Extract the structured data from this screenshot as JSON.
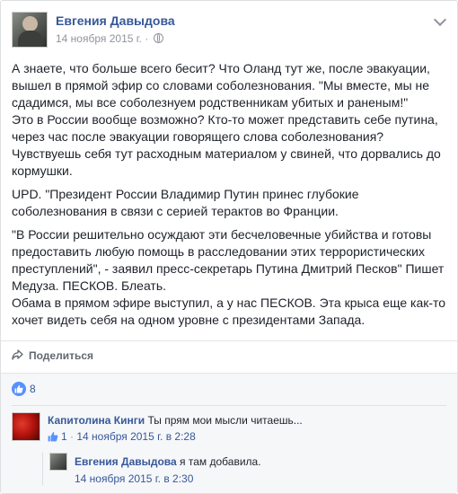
{
  "post": {
    "author": "Евгения Давыдова",
    "date": "14 ноября 2015 г.",
    "paragraphs": [
      "А знаете, что больше всего бесит? Что Оланд тут же, после эвакуации, вышел в прямой эфир со словами соболезнования. \"Мы вместе, мы не сдадимся, мы все соболезнуем родственникам убитых и раненым!\"\nЭто в России вообще возможно? Кто-то может представить себе путина, через час после эвакуации говорящего слова соболезнования? Чувствуешь себя тут расходным материалом у свиней, что дорвались до кормушки.",
      "UPD. \"Президент России Владимир Путин принес глубокие соболезнования в связи с серией терактов во Франции.",
      "\"В России решительно осуждают эти бесчеловечные убийства и готовы предоставить любую помощь в расследовании этих террористических преступлений\", - заявил пресс-секретарь Путина Дмитрий Песков\" Пишет Медуза. ПЕСКОВ. Блеать.\nОбама в прямом эфире выступил, а у нас ПЕСКОВ. Эта крыса еще как-то хочет видеть себя на одном уровне с президентами Запада."
    ]
  },
  "actions": {
    "share_label": "Поделиться"
  },
  "feedback": {
    "like_count": "8"
  },
  "comments": [
    {
      "author": "Капитолина Кинги",
      "text": "Ты прям мои мысли читаешь...",
      "likes": "1",
      "separator": " · ",
      "time": "14 ноября 2015 г. в 2:28"
    },
    {
      "author": "Евгения Давыдова",
      "text": "я там добавила.",
      "time": "14 ноября 2015 г. в 2:30"
    }
  ],
  "colors": {
    "link": "#365899",
    "meta": "#90949c",
    "like_blue": "#5890ff"
  }
}
